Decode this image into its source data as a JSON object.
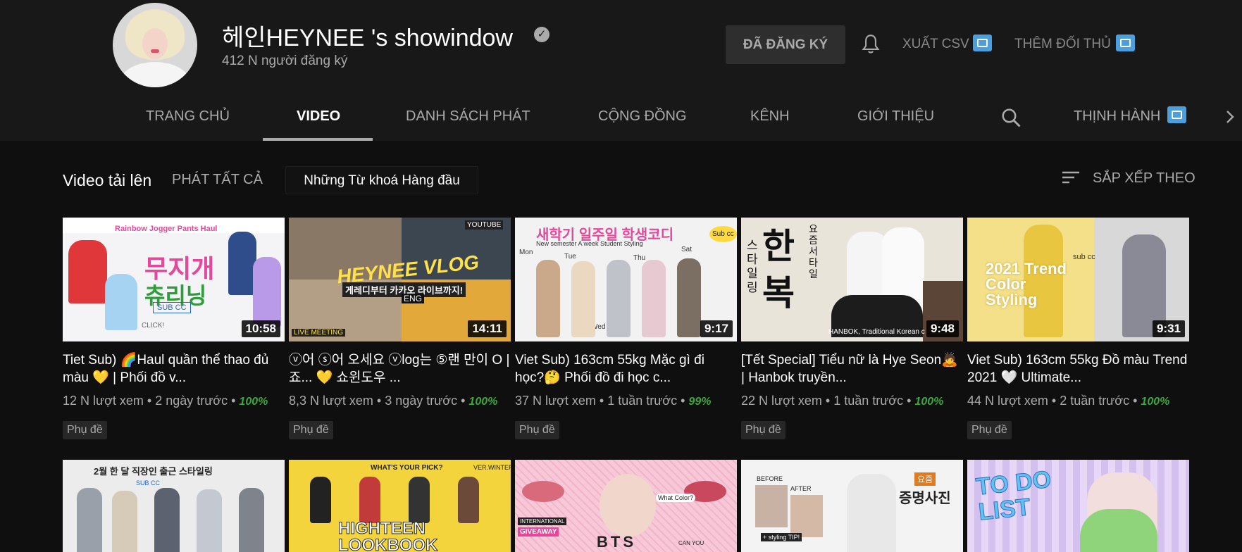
{
  "channel": {
    "name": "헤인HEYNEE 's showindow",
    "subscribers": "412 N người đăng ký",
    "subscribed_label": "ĐÃ ĐĂNG KÝ",
    "export_csv_label": "XUẤT CSV",
    "add_rival_label": "THÊM ĐỐI THỦ"
  },
  "tabs": [
    {
      "label": "TRANG CHỦ"
    },
    {
      "label": "VIDEO"
    },
    {
      "label": "DANH SÁCH PHÁT"
    },
    {
      "label": "CỘNG ĐỒNG"
    },
    {
      "label": "KÊNH"
    },
    {
      "label": "GIỚI THIỆU"
    },
    {
      "label": "THỊNH HÀNH"
    }
  ],
  "section": {
    "title": "Video tải lên",
    "play_all": "PHÁT TẤT CẢ",
    "keywords": "Những Từ khoá Hàng đầu",
    "sort": "SẮP XẾP THEO"
  },
  "videos": [
    {
      "title": "Tiet Sub) 🌈Haul quần thể thao đủ màu 💛 | Phối đồ v...",
      "views": "12 N lượt xem",
      "age": "2 ngày trước",
      "score": "100%",
      "duration": "10:58",
      "badge": "Phụ đề",
      "thumb_texts": [
        "Rainbow Jogger Pants Haul",
        "무지개",
        "츄리닝",
        "SUB CC",
        "CLICK!"
      ]
    },
    {
      "title": "ⓥ어 ⓢ어 오세요 ⓥlog는 ⑤랜 만이 O | 죠... 💛 쇼윈도우 ...",
      "views": "8,3 N lượt xem",
      "age": "3 ngày trước",
      "score": "100%",
      "duration": "14:11",
      "badge": "Phụ đề",
      "thumb_texts": [
        "HEYNEE VLOG",
        "게레디부터 카카오 라이브까지!",
        "ENG",
        "LIVE MEETING",
        "YOUTUBE"
      ]
    },
    {
      "title": "Viet Sub) 163cm 55kg Mặc gì đi học?🤔 Phối đồ đi học c...",
      "views": "37 N lượt xem",
      "age": "1 tuần trước",
      "score": "99%",
      "duration": "9:17",
      "badge": "Phụ đề",
      "thumb_texts": [
        "새학기 일주일 학생코디",
        "New semester  A week  Student Styling",
        "Mon",
        "Tue",
        "Wed",
        "Thu",
        "Sat",
        "Sub cc"
      ]
    },
    {
      "title": "[Tết Special] Tiểu nữ là Hye Seon🙇 | Hanbok truyền...",
      "views": "22 N lượt xem",
      "age": "1 tuần trước",
      "score": "100%",
      "duration": "9:48",
      "badge": "Phụ đề",
      "thumb_texts": [
        "한복",
        "스타일링",
        "요즘서타일",
        "HANBOK, Traditional Korean c"
      ]
    },
    {
      "title": "Viet Sub) 163cm 55kg Đồ màu Trend 2021 🤍 Ultimate...",
      "views": "44 N lượt xem",
      "age": "2 tuần trước",
      "score": "100%",
      "duration": "9:31",
      "badge": "Phụ đề",
      "thumb_texts": [
        "2021 Trend Color Styling",
        "sub cc"
      ]
    },
    {
      "title": "",
      "views": "",
      "age": "",
      "score": "",
      "duration": "",
      "badge": "",
      "thumb_texts": [
        "2월 한 달 직장인 출근 스타일링",
        "SUB CC"
      ]
    },
    {
      "title": "",
      "views": "",
      "age": "",
      "score": "",
      "duration": "",
      "badge": "",
      "thumb_texts": [
        "WHAT'S YOUR PICK?",
        "VER.WINTER",
        "HIGHTEEN",
        "LOOKBOOK"
      ]
    },
    {
      "title": "",
      "views": "",
      "age": "",
      "score": "",
      "duration": "",
      "badge": "",
      "thumb_texts": [
        "INTERNATIONAL",
        "GIVEAWAY",
        "What Color?",
        "BTS",
        "CAN YOU"
      ]
    },
    {
      "title": "",
      "views": "",
      "age": "",
      "score": "",
      "duration": "",
      "badge": "",
      "thumb_texts": [
        "BEFORE",
        "AFTER",
        "요즘",
        "증명사진",
        "+ styling TIP!"
      ]
    },
    {
      "title": "",
      "views": "",
      "age": "",
      "score": "",
      "duration": "",
      "badge": "",
      "thumb_texts": [
        "TO DO LIST"
      ]
    }
  ],
  "colors": {
    "header_bg": "#181818",
    "page_bg": "#0f0f0f",
    "vidiq_blue": "#4a9fdc",
    "score_green": "#3ea63e"
  }
}
